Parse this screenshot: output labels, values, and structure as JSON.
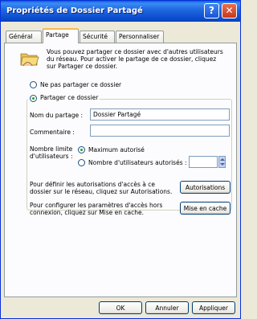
{
  "window": {
    "title": "Propriétés de Dossier Partagé",
    "help_glyph": "?",
    "close_glyph": "✕"
  },
  "tabs": [
    {
      "label": "Général"
    },
    {
      "label": "Partage"
    },
    {
      "label": "Sécurité"
    },
    {
      "label": "Personnaliser"
    }
  ],
  "sharing": {
    "intro_line1": "Vous pouvez partager ce dossier avec d'autres utilisateurs",
    "intro_line2": "du réseau. Pour activer le partage de ce dossier, cliquez",
    "intro_line3": "sur Partager ce dossier.",
    "option_no_share": "Ne pas partager ce dossier",
    "option_share": "Partager ce dossier",
    "share_name_label": "Nom du partage :",
    "share_name_value": "Dossier Partagé",
    "comment_label": "Commentaire :",
    "comment_value": "",
    "user_limit_label1": "Nombre limite",
    "user_limit_label2": "d'utilisateurs :",
    "option_max": "Maximum autorisé",
    "option_count": "Nombre d'utilisateurs autorisés :",
    "permissions_line1": "Pour définir les autorisations d'accès à ce",
    "permissions_line2": "dossier sur le réseau, cliquez sur Autorisations.",
    "permissions_button": "Autorisations",
    "cache_line1": "Pour configurer les paramètres d'accès hors",
    "cache_line2": "connexion, cliquez sur Mise en cache.",
    "cache_button": "Mise en cache"
  },
  "footer": {
    "ok": "OK",
    "cancel": "Annuler",
    "apply": "Appliquer"
  }
}
